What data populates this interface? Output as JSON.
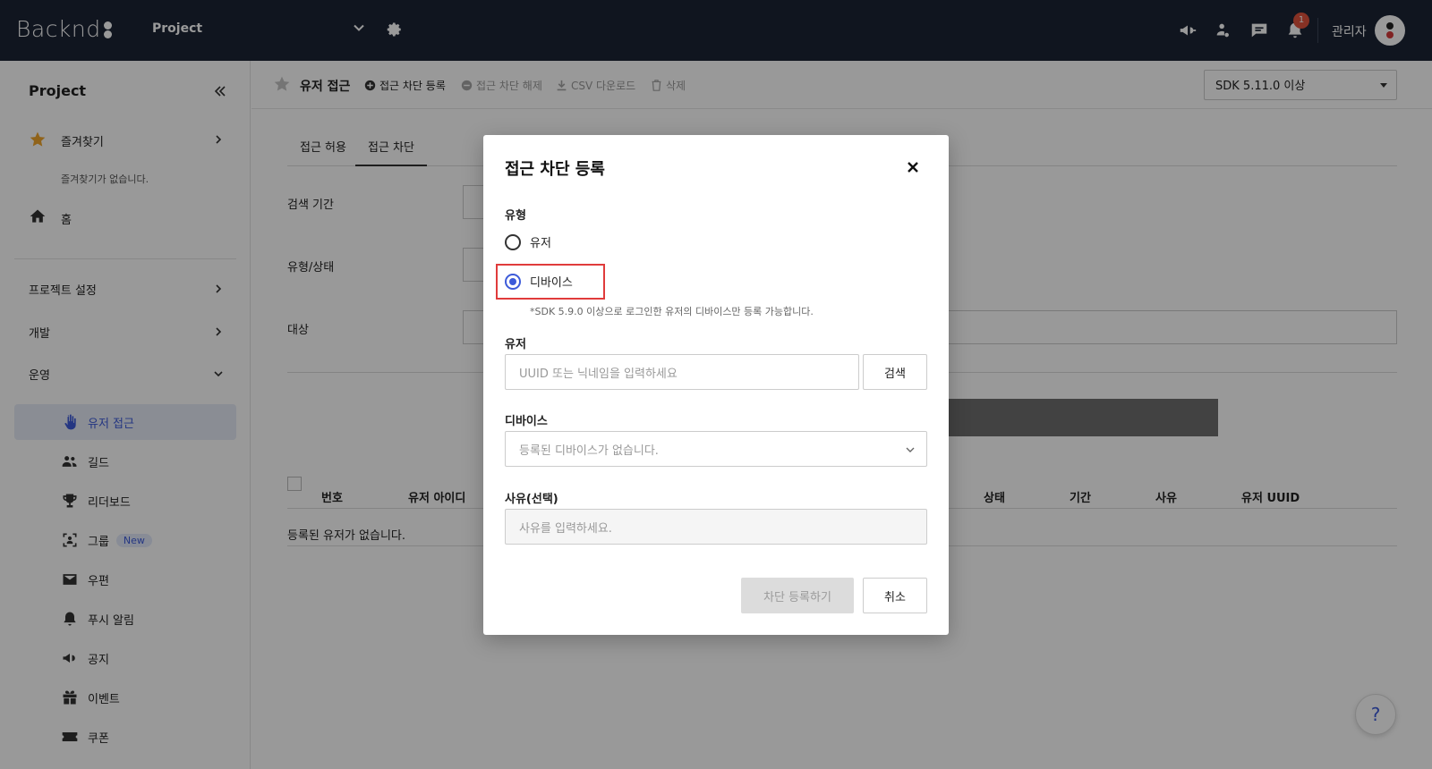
{
  "topbar": {
    "logo": "Backnd",
    "project": "Project",
    "notification_count": "1",
    "admin_name": "관리자"
  },
  "sidebar": {
    "title": "Project",
    "favorites": {
      "label": "즐겨찾기",
      "empty": "즐겨찾기가 없습니다."
    },
    "home": "홈",
    "sections": [
      {
        "label": "프로젝트 설정"
      },
      {
        "label": "개발"
      },
      {
        "label": "운영"
      }
    ],
    "items": [
      {
        "label": "유저 접근"
      },
      {
        "label": "길드"
      },
      {
        "label": "리더보드"
      },
      {
        "label": "그룹",
        "badge": "New"
      },
      {
        "label": "우편"
      },
      {
        "label": "푸시 알림"
      },
      {
        "label": "공지"
      },
      {
        "label": "이벤트"
      },
      {
        "label": "쿠폰"
      }
    ]
  },
  "toolbar": {
    "title": "유저 접근",
    "actions": [
      {
        "label": "접근 차단 등록"
      },
      {
        "label": "접근 차단 해제"
      },
      {
        "label": "CSV 다운로드"
      },
      {
        "label": "삭제"
      }
    ],
    "sdk_select": "SDK 5.11.0 이상"
  },
  "main": {
    "tabs": [
      {
        "label": "접근 허용"
      },
      {
        "label": "접근 차단"
      }
    ],
    "form_labels": {
      "period": "검색 기간",
      "type_status": "유형/상태",
      "target": "대상"
    },
    "table": {
      "headers": [
        "번호",
        "유저 아이디",
        "상태",
        "기간",
        "사유",
        "유저 UUID"
      ],
      "empty": "등록된 유저가 없습니다."
    }
  },
  "help": "?",
  "modal": {
    "title": "접근 차단 등록",
    "type_label": "유형",
    "options": [
      {
        "label": "유저",
        "checked": false
      },
      {
        "label": "디바이스",
        "checked": true
      }
    ],
    "hint": "*SDK 5.9.0 이상으로 로그인한 유저의 디바이스만 등록 가능합니다.",
    "user_label": "유저",
    "user_placeholder": "UUID 또는 닉네임을 입력하세요",
    "search_button": "검색",
    "device_label": "디바이스",
    "device_placeholder": "등록된 디바이스가 없습니다.",
    "reason_label": "사유(선택)",
    "reason_placeholder": "사유를 입력하세요.",
    "submit_button": "차단 등록하기",
    "cancel_button": "취소"
  },
  "colors": {
    "topbar": "#1b2335",
    "accent": "#3d5bd9",
    "highlight": "#e03b3b"
  }
}
